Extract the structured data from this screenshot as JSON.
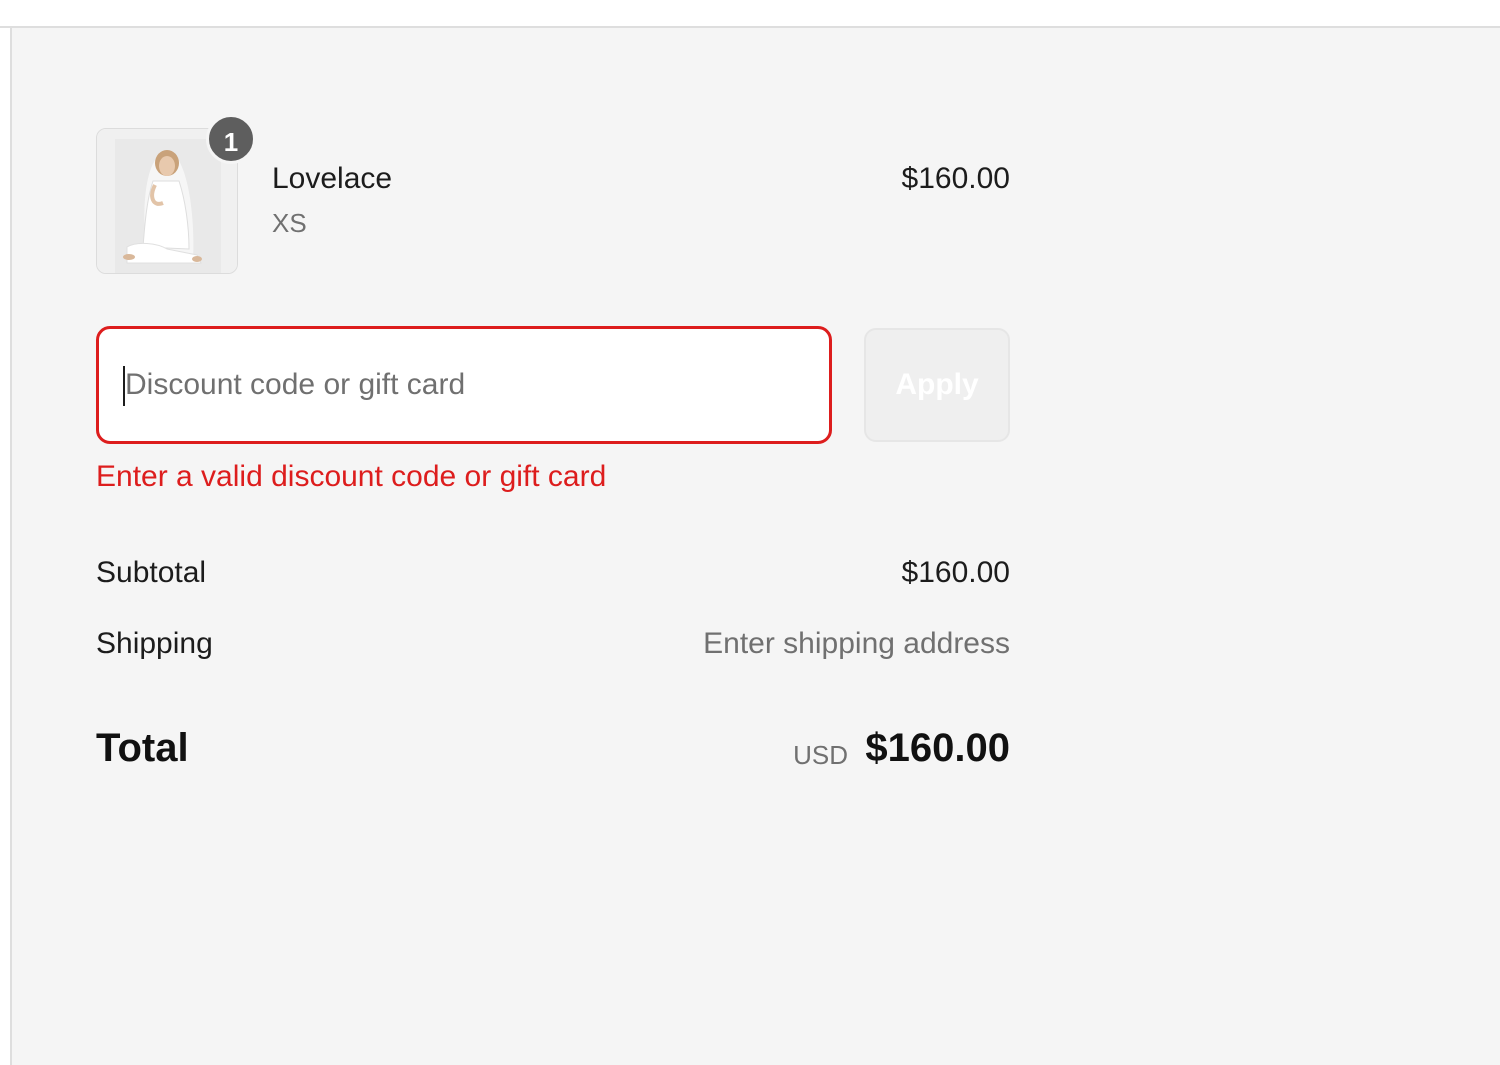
{
  "order_summary": {
    "line_items": [
      {
        "quantity": "1",
        "name": "Lovelace",
        "variant": "XS",
        "price": "$160.00",
        "image_icon": "product-photo-woman-white-dress"
      }
    ],
    "discount": {
      "placeholder": "Discount code or gift card",
      "value": "",
      "apply_label": "Apply",
      "error": "Enter a valid discount code or gift card"
    },
    "subtotal": {
      "label": "Subtotal",
      "value": "$160.00"
    },
    "shipping": {
      "label": "Shipping",
      "value": "Enter shipping address"
    },
    "total": {
      "label": "Total",
      "currency": "USD",
      "value": "$160.00"
    }
  },
  "colors": {
    "panel_bg": "#f5f5f5",
    "error": "#dd1d1d",
    "text": "#1c1c1c",
    "muted": "#707070",
    "badge": "#5e5e5e"
  }
}
